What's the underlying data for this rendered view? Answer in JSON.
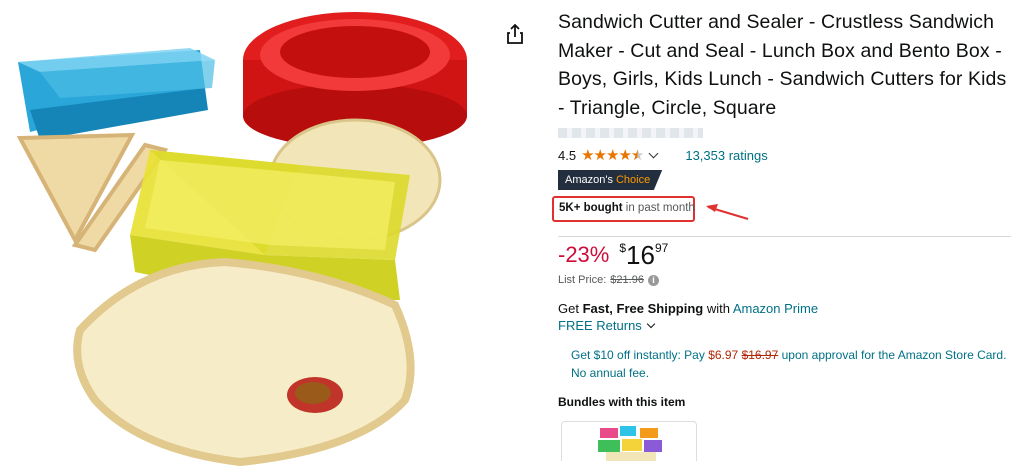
{
  "product": {
    "title": "Sandwich Cutter and Sealer - Crustless Sandwich Maker - Cut and Seal - Lunch Box and Bento Box - Boys, Girls, Kids Lunch - Sandwich Cutters for Kids - Triangle, Circle, Square",
    "image_alt": "Sandwich cutters in blue, red and yellow with crustless sealed sandwiches"
  },
  "share": {
    "icon": "share-icon"
  },
  "rating": {
    "value": "4.5",
    "stars_fraction": 0.9,
    "ratings_text": "13,353 ratings"
  },
  "badge": {
    "prefix": "Amazon's",
    "highlight": "Choice"
  },
  "bought": {
    "bold": "5K+ bought",
    "rest": " in past month"
  },
  "price": {
    "discount": "-23%",
    "symbol": "$",
    "whole": "16",
    "fraction": "97",
    "list_label": "List Price:",
    "list_value": "$21.96"
  },
  "shipping": {
    "get": "Get ",
    "fast_free": "Fast, Free Shipping",
    "with": " with ",
    "prime_link": "Amazon Prime",
    "returns": "FREE Returns"
  },
  "card_offer": {
    "prefix": "Get $10 off instantly: Pay ",
    "new_price": "$6.97",
    "old_price": "$16.97",
    "suffix": " upon approval for the Amazon Store Card. No annual fee."
  },
  "bundles": {
    "heading": "Bundles with this item"
  },
  "colors": {
    "link": "#007185",
    "star": "#E77600",
    "discount": "#CC0C39",
    "badge_bg": "#232F3E",
    "badge_accent": "#FF9900",
    "annotation": "#E03030"
  }
}
